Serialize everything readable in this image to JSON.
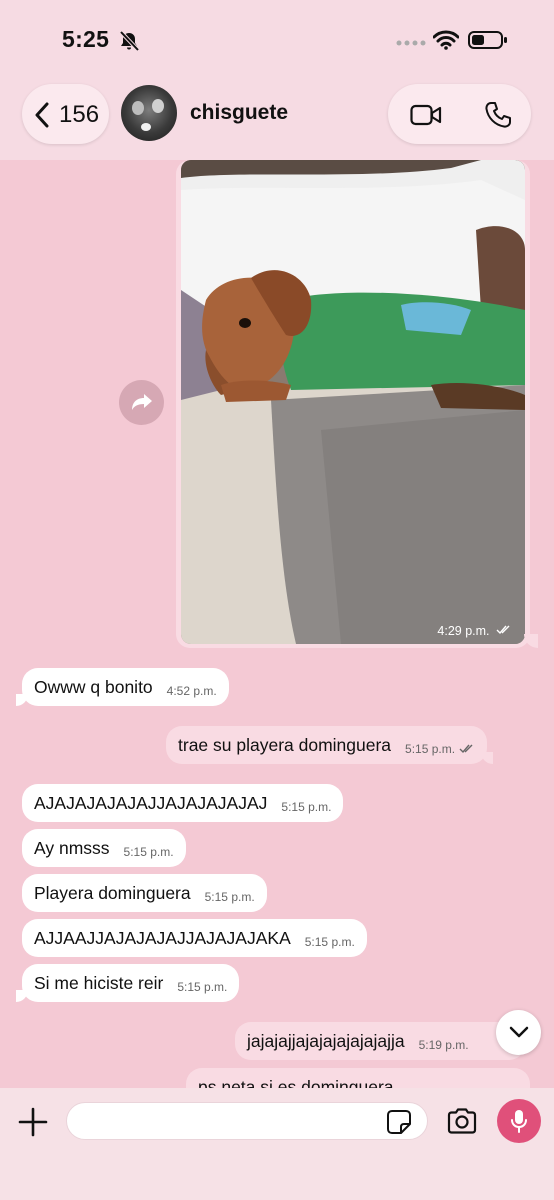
{
  "status_bar": {
    "time": "5:25"
  },
  "header": {
    "back_count": "156",
    "contact_name": "chisguete"
  },
  "photo_message": {
    "time": "4:29 p.m."
  },
  "messages": [
    {
      "text": "Owww q bonito",
      "time": "4:52 p.m."
    },
    {
      "text": "trae su playera dominguera",
      "time": "5:15 p.m."
    },
    {
      "text": "AJAJAJAJAJAJJAJAJAJAJAJ",
      "time": "5:15 p.m."
    },
    {
      "text": "Ay nmsss",
      "time": "5:15 p.m."
    },
    {
      "text": "Playera dominguera",
      "time": "5:15 p.m."
    },
    {
      "text": "AJJAAJJAJAJAJAJJAJAJAJAKA",
      "time": "5:15 p.m."
    },
    {
      "text": "Si me hiciste reir",
      "time": "5:15 p.m."
    },
    {
      "text": "jajajajjajajajajajajajja",
      "time": "5:19 p.m."
    },
    {
      "text": "ps neta si es dominguera",
      "time": ""
    }
  ],
  "colors": {
    "background": "#f4c9d4",
    "outgoing_bubble": "#f9dbe3",
    "incoming_bubble": "#ffffff",
    "mic_accent": "#e0507a"
  },
  "icons": [
    "bell-slash-icon",
    "wifi-icon",
    "battery-icon",
    "chevron-left-icon",
    "video-camera-icon",
    "phone-icon",
    "forward-icon",
    "chevron-down-icon",
    "plus-icon",
    "sticker-icon",
    "camera-icon",
    "microphone-icon"
  ]
}
